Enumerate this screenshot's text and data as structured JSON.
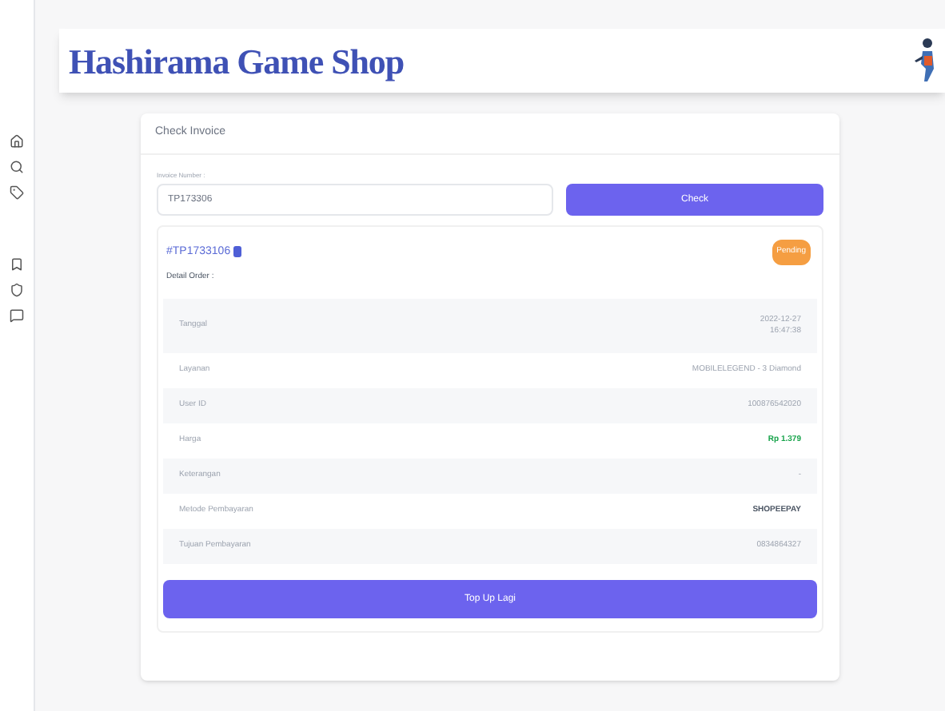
{
  "header": {
    "title": "Hashirama Game Shop"
  },
  "card": {
    "title": "Check Invoice",
    "field": {
      "label": "Invoice Number :",
      "value": "TP173306"
    },
    "check_button": "Check",
    "invoice": {
      "number": "#TP1733106",
      "status": "Pending",
      "detail_title": "Detail Order :",
      "rows": [
        {
          "label": "Tanggal",
          "value": "2022-12-27",
          "value_2": "16:47:38",
          "kind": "normal"
        },
        {
          "label": "Layanan",
          "value": "MOBILELEGEND - 3 Diamond",
          "kind": "normal"
        },
        {
          "label": "User ID",
          "value": "100876542020",
          "kind": "normal"
        },
        {
          "label": "Harga",
          "value": "Rp 1.379",
          "kind": "price"
        },
        {
          "label": "Keterangan",
          "value": "-",
          "kind": "normal"
        },
        {
          "label": "Metode Pembayaran",
          "value": "SHOPEEPAY",
          "kind": "strong"
        },
        {
          "label": "Tujuan Pembayaran",
          "value": "0834864327",
          "kind": "normal"
        }
      ],
      "topup_button": "Top Up Lagi"
    }
  }
}
